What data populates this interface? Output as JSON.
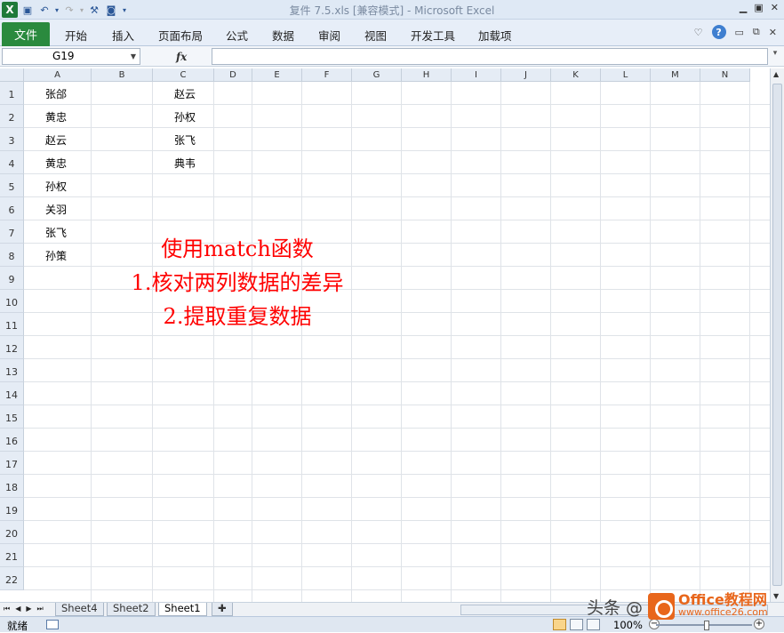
{
  "window": {
    "title": "复件 7.5.xls  [兼容模式] - Microsoft Excel"
  },
  "ribbon": {
    "file_tab": "文件",
    "tabs": [
      "开始",
      "插入",
      "页面布局",
      "公式",
      "数据",
      "审阅",
      "视图",
      "开发工具",
      "加载项"
    ]
  },
  "formula_bar": {
    "name_box": "G19",
    "fx": "fx",
    "formula": ""
  },
  "columns": [
    "A",
    "B",
    "C",
    "D",
    "E",
    "F",
    "G",
    "H",
    "I",
    "J",
    "K",
    "L",
    "M",
    "N"
  ],
  "rows": [
    "1",
    "2",
    "3",
    "4",
    "5",
    "6",
    "7",
    "8",
    "9",
    "10",
    "11",
    "12",
    "13",
    "14",
    "15",
    "16",
    "17",
    "18",
    "19",
    "20",
    "21",
    "22"
  ],
  "cells": {
    "A": [
      "张郃",
      "黄忠",
      "赵云",
      "黄忠",
      "孙权",
      "关羽",
      "张飞",
      "孙策"
    ],
    "C": [
      "赵云",
      "孙权",
      "张飞",
      "典韦"
    ]
  },
  "annotation": {
    "line1": "使用match函数",
    "line2": "1.核对两列数据的差异",
    "line3": "2.提取重复数据",
    "color": "#ff0000"
  },
  "sheet_tabs": [
    "Sheet4",
    "Sheet2",
    "Sheet1"
  ],
  "active_sheet": "Sheet1",
  "status": {
    "ready": "就绪",
    "zoom": "100%"
  },
  "watermark": {
    "text": "头条 @",
    "brand": "Office教程网",
    "url": "www.office26.com"
  },
  "colors": {
    "file_tab": "#2a8a3e",
    "ribbon_bg": "#e7eef8",
    "header_bg": "#e5ecf5"
  }
}
